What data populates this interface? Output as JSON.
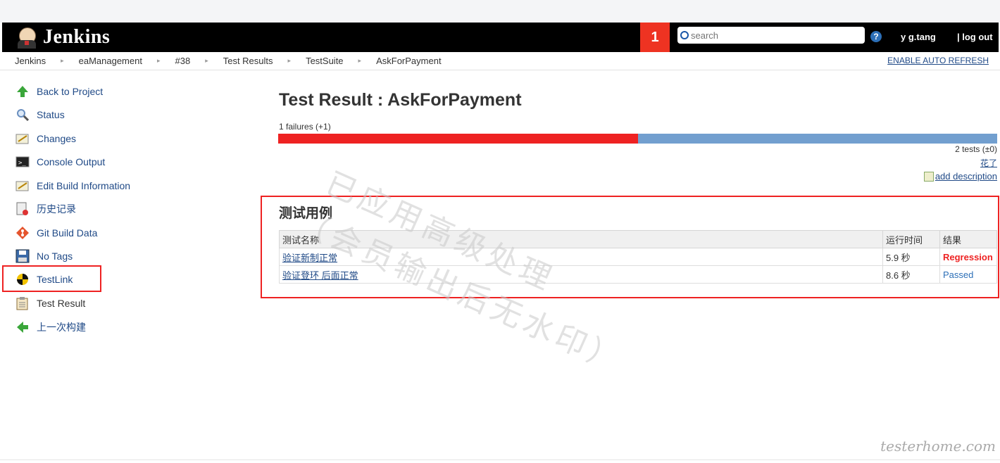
{
  "header": {
    "app_title": "Jenkins",
    "notification_count": "1",
    "search_placeholder": "search",
    "user": "y   g.tang",
    "logout": "| log out"
  },
  "breadcrumb": {
    "items": [
      "Jenkins",
      "eaManagement",
      "#38",
      "Test Results",
      "TestSuite",
      "AskForPayment"
    ],
    "auto_refresh": "ENABLE AUTO REFRESH"
  },
  "sidebar": {
    "items": [
      {
        "label": "Back to Project",
        "icon": "up-arrow-icon"
      },
      {
        "label": "Status",
        "icon": "magnifier-icon"
      },
      {
        "label": "Changes",
        "icon": "notepad-icon"
      },
      {
        "label": "Console Output",
        "icon": "terminal-icon"
      },
      {
        "label": "Edit Build Information",
        "icon": "notepad-icon"
      },
      {
        "label": "历史记录",
        "icon": "history-icon"
      },
      {
        "label": "Git Build Data",
        "icon": "git-icon"
      },
      {
        "label": "No Tags",
        "icon": "save-icon"
      },
      {
        "label": "TestLink",
        "icon": "testlink-icon"
      },
      {
        "label": "Test Result",
        "icon": "clipboard-icon"
      },
      {
        "label": "上一次构建",
        "icon": "left-arrow-icon"
      }
    ],
    "selected": "Test Result"
  },
  "main": {
    "title": "Test Result : AskForPayment",
    "failures": "1 failures (+1)",
    "fail_fraction": 0.5,
    "tests": "2 tests (±0)",
    "cost": "花了",
    "add_description": "add description",
    "section_title": "测试用例",
    "columns": [
      "测试名称",
      "运行时间",
      "结果"
    ],
    "rows": [
      {
        "name_a": "验证新",
        "name_b": "      ",
        "name_c": "制正常",
        "time": "5.9 秒",
        "result": "Regression"
      },
      {
        "name_a": "验证登",
        "name_b": "               ",
        "name_c": "环    后面正常",
        "time": "8.6 秒",
        "result": "Passed"
      }
    ]
  },
  "watermark": {
    "line1": "已应用高级处理",
    "line2": "（会员输出后无水印）",
    "signature": "testerhome.com"
  },
  "colors": {
    "accent_red": "#ee2222",
    "link": "#204a87",
    "progress_pass": "#729fcf"
  }
}
